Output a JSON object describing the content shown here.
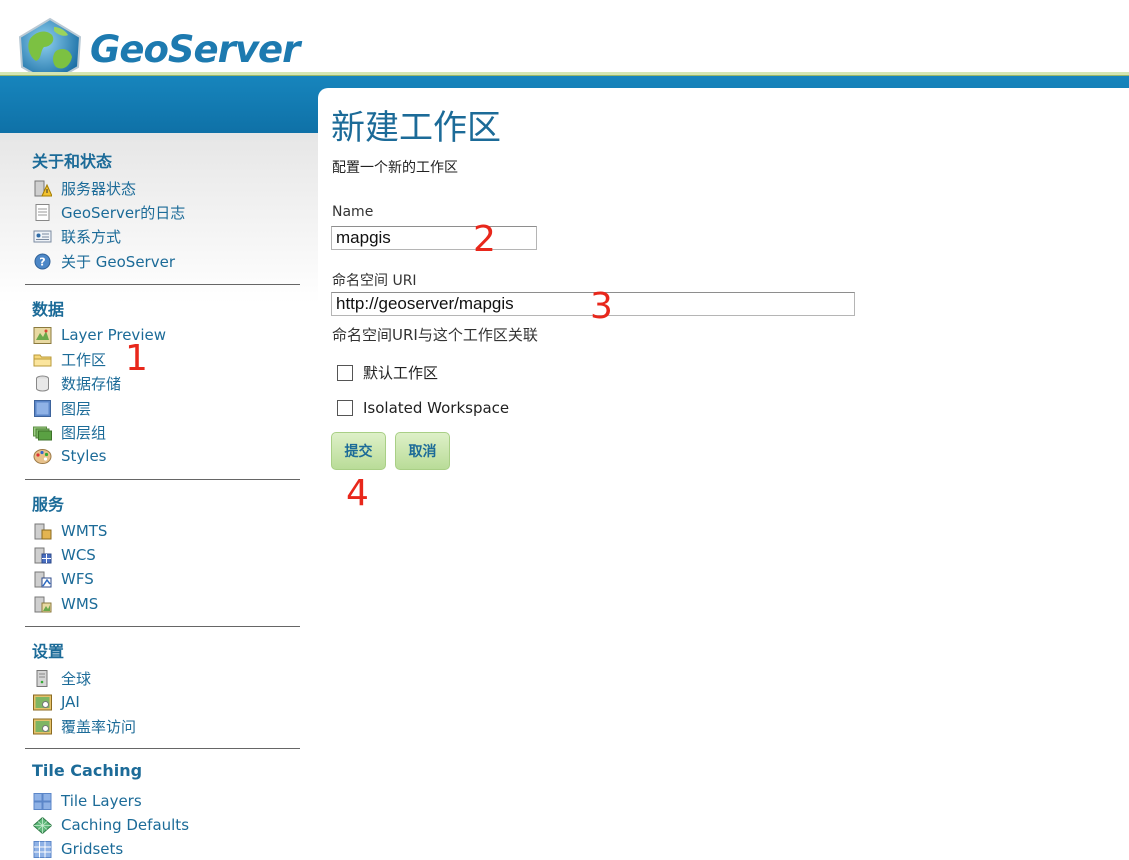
{
  "header": {
    "logo_text": "GeoServer"
  },
  "sidebar": {
    "sections": [
      {
        "title": "关于和状态",
        "items": [
          {
            "label": "服务器状态",
            "icon": "server-status-icon"
          },
          {
            "label": "GeoServer的日志",
            "icon": "log-document-icon"
          },
          {
            "label": "联系方式",
            "icon": "contact-card-icon"
          },
          {
            "label": "关于 GeoServer",
            "icon": "about-help-icon"
          }
        ]
      },
      {
        "title": "数据",
        "items": [
          {
            "label": "Layer Preview",
            "icon": "layer-preview-icon"
          },
          {
            "label": "工作区",
            "icon": "folder-icon"
          },
          {
            "label": "数据存储",
            "icon": "datastore-icon"
          },
          {
            "label": "图层",
            "icon": "layer-icon"
          },
          {
            "label": "图层组",
            "icon": "layer-group-icon"
          },
          {
            "label": "Styles",
            "icon": "styles-palette-icon"
          }
        ]
      },
      {
        "title": "服务",
        "items": [
          {
            "label": "WMTS",
            "icon": "wmts-service-icon"
          },
          {
            "label": "WCS",
            "icon": "wcs-service-icon"
          },
          {
            "label": "WFS",
            "icon": "wfs-service-icon"
          },
          {
            "label": "WMS",
            "icon": "wms-service-icon"
          }
        ]
      },
      {
        "title": "设置",
        "items": [
          {
            "label": "全球",
            "icon": "global-server-icon"
          },
          {
            "label": "JAI",
            "icon": "jai-image-icon"
          },
          {
            "label": "覆盖率访问",
            "icon": "coverage-access-icon"
          }
        ]
      },
      {
        "title": "Tile Caching",
        "items": [
          {
            "label": "Tile Layers",
            "icon": "tile-layers-icon"
          },
          {
            "label": "Caching Defaults",
            "icon": "caching-defaults-icon"
          },
          {
            "label": "Gridsets",
            "icon": "gridsets-icon"
          }
        ]
      }
    ]
  },
  "main": {
    "title": "新建工作区",
    "subtitle": "配置一个新的工作区",
    "name_label": "Name",
    "name_value": "mapgis",
    "uri_label": "命名空间 URI",
    "uri_value": "http://geoserver/mapgis",
    "uri_hint": "命名空间URI与这个工作区关联",
    "default_workspace_label": "默认工作区",
    "isolated_workspace_label": "Isolated Workspace",
    "default_workspace_checked": false,
    "isolated_workspace_checked": false,
    "submit_label": "提交",
    "cancel_label": "取消"
  },
  "annotations": [
    "1",
    "2",
    "3",
    "4"
  ],
  "colors": {
    "brand_blue": "#1c6b98",
    "header_band": "#1785bd",
    "button_green": "#c9e6ad",
    "annotation_red": "#e8271b"
  }
}
